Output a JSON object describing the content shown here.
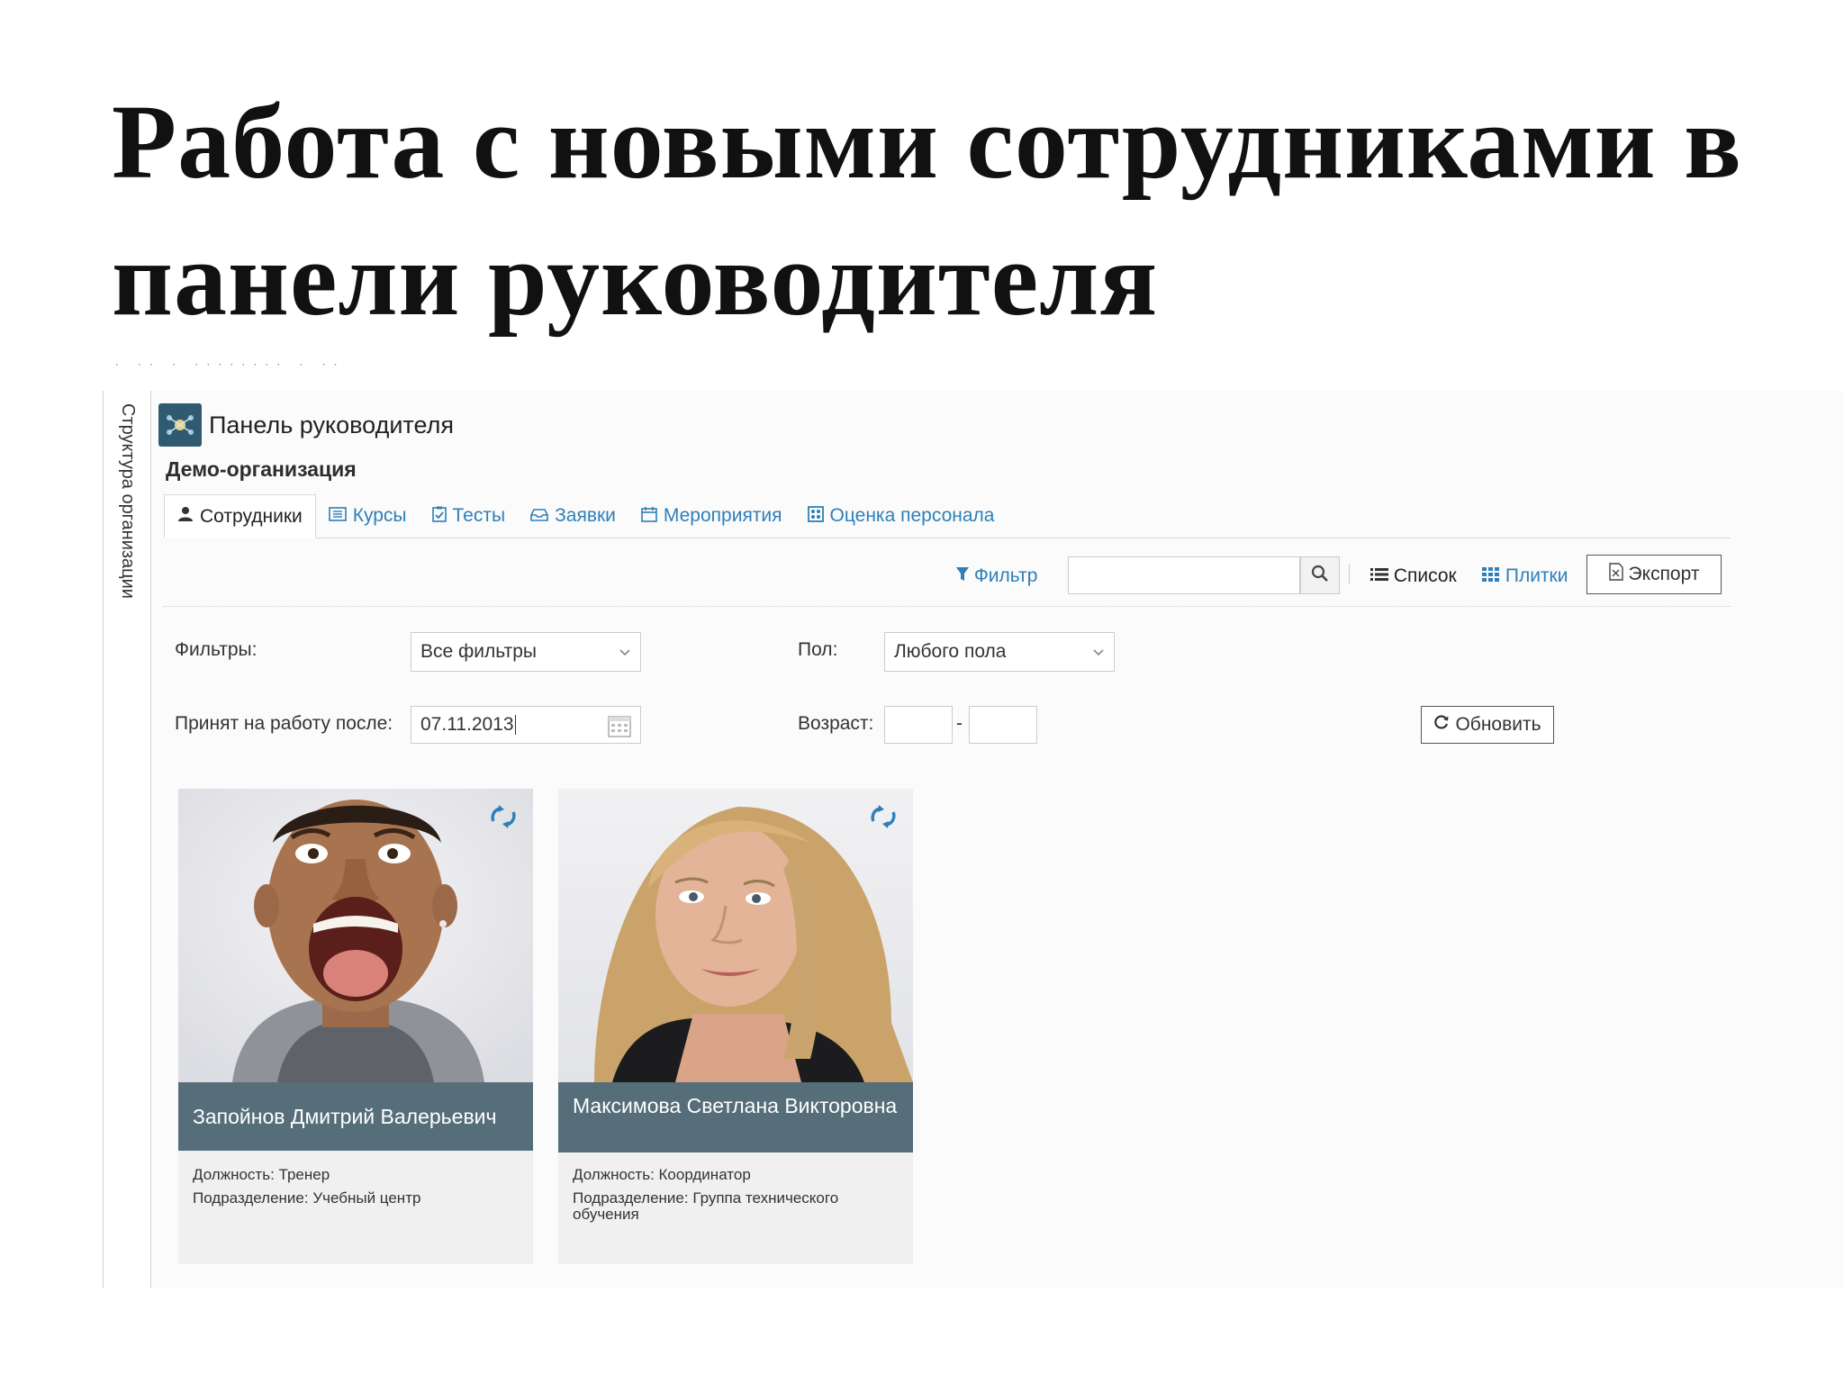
{
  "slide": {
    "title_line1": "Работа с новыми сотрудниками в",
    "title_line2": "панели руководителя"
  },
  "sidebar": {
    "label": "Структура организации"
  },
  "panel": {
    "title": "Панель руководителя",
    "org_name": "Демо-организация"
  },
  "tabs": [
    {
      "label": "Сотрудники",
      "icon": "user-icon",
      "active": true
    },
    {
      "label": "Курсы",
      "icon": "book-icon"
    },
    {
      "label": "Тесты",
      "icon": "clipboard-check-icon"
    },
    {
      "label": "Заявки",
      "icon": "inbox-icon"
    },
    {
      "label": "Мероприятия",
      "icon": "calendar-icon"
    },
    {
      "label": "Оценка персонала",
      "icon": "assessment-icon"
    }
  ],
  "toolbar": {
    "filter_label": "Фильтр",
    "search_value": "",
    "view_list_label": "Список",
    "view_tiles_label": "Плитки",
    "export_label": "Экспорт"
  },
  "filters": {
    "filters_label": "Фильтры:",
    "filters_value": "Все фильтры",
    "gender_label": "Пол:",
    "gender_value": "Любого пола",
    "hired_after_label": "Принят на работу после:",
    "hired_after_value": "07.11.2013",
    "age_label": "Возраст:",
    "age_from": "",
    "age_to": "",
    "age_separator": "-",
    "refresh_label": "Обновить"
  },
  "employees": [
    {
      "name": "Запойнов Дмитрий Валерьевич",
      "position": "Должность: Тренер",
      "department": "Подразделение: Учебный центр"
    },
    {
      "name": "Максимова Светлана Викторовна",
      "position": "Должность: Координатор",
      "department": "Подразделение: Группа технического обучения"
    }
  ],
  "colors": {
    "link": "#2e7fb8",
    "card_name_bg": "#566e7a",
    "logo_bg": "#2f5a72"
  }
}
